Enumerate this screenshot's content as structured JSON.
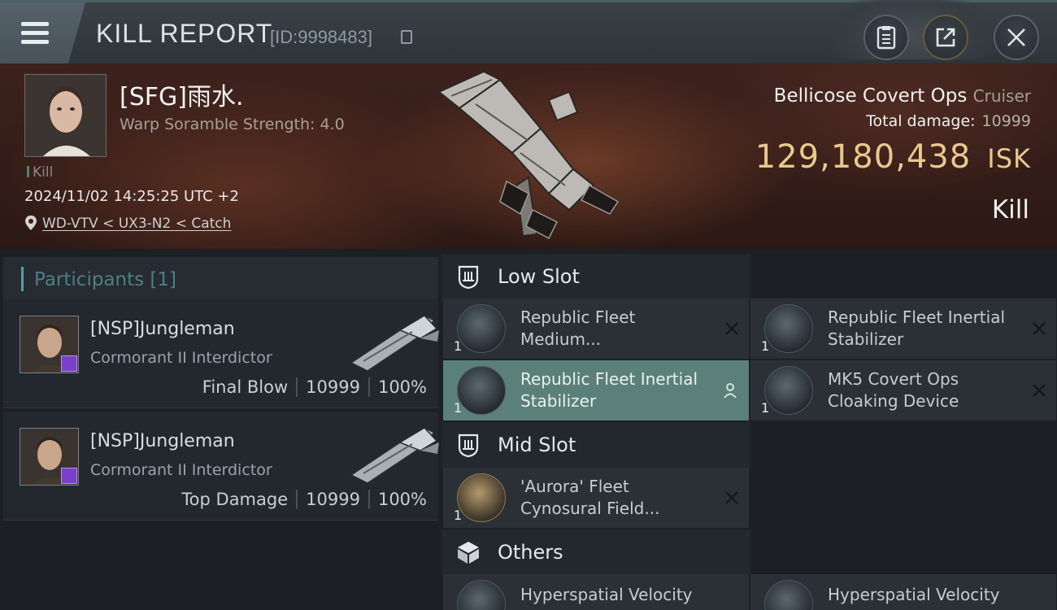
{
  "header": {
    "title": "KILL REPORT",
    "id_text": "[ID:9998483]"
  },
  "victim": {
    "name": "[SFG]雨水.",
    "subtitle": "Warp Soramble Strength: 4.0",
    "tag": "Kill",
    "datetime": "2024/11/02 14:25:25 UTC +2",
    "location": "WD-VTV < UX3-N2 < Catch",
    "ship_name": "Bellicose Covert Ops",
    "ship_class": "Cruiser",
    "damage_label": "Total damage:",
    "damage_value": "10999",
    "isk_value": "129,180,438",
    "isk_unit": "ISK",
    "result": "Kill"
  },
  "participants": {
    "title": "Participants",
    "count": "[1]",
    "items": [
      {
        "name": "[NSP]Jungleman",
        "ship": "Cormorant II Interdictor",
        "role": "Final Blow",
        "damage": "10999",
        "percent": "100%"
      },
      {
        "name": "[NSP]Jungleman",
        "ship": "Cormorant II Interdictor",
        "role": "Top Damage",
        "damage": "10999",
        "percent": "100%"
      }
    ]
  },
  "fitting": {
    "low_slot": {
      "title": "Low Slot",
      "modules": [
        {
          "qty": "1",
          "line1": "Republic Fleet",
          "line2": "Medium..."
        },
        {
          "qty": "1",
          "line1": "Republic Fleet Inertial",
          "line2": "Stabilizer"
        },
        {
          "qty": "1",
          "line1": "Republic Fleet Inertial",
          "line2": "Stabilizer"
        },
        {
          "qty": "1",
          "line1": "MK5 Covert Ops",
          "line2": "Cloaking Device"
        }
      ]
    },
    "mid_slot": {
      "title": "Mid Slot",
      "modules": [
        {
          "qty": "1",
          "line1": "'Aurora' Fleet",
          "line2": "Cynosural Field..."
        }
      ]
    },
    "others": {
      "title": "Others",
      "modules": [
        {
          "qty": "",
          "line1": "Hyperspatial Velocity",
          "line2": ""
        },
        {
          "qty": "",
          "line1": "Hyperspatial Velocity",
          "line2": ""
        }
      ]
    }
  },
  "colors": {
    "accent_gold": "#e9c88e",
    "selected_row": "#5b8079",
    "participants_teal": "#4f7e86",
    "badge_purple": "#7b3fcc"
  },
  "icons": [
    "menu-icon",
    "copy-icon",
    "clipboard-icon",
    "export-icon",
    "close-icon",
    "location-pin-icon",
    "slot-icon",
    "cube-icon",
    "remove-x-icon",
    "person-icon"
  ]
}
